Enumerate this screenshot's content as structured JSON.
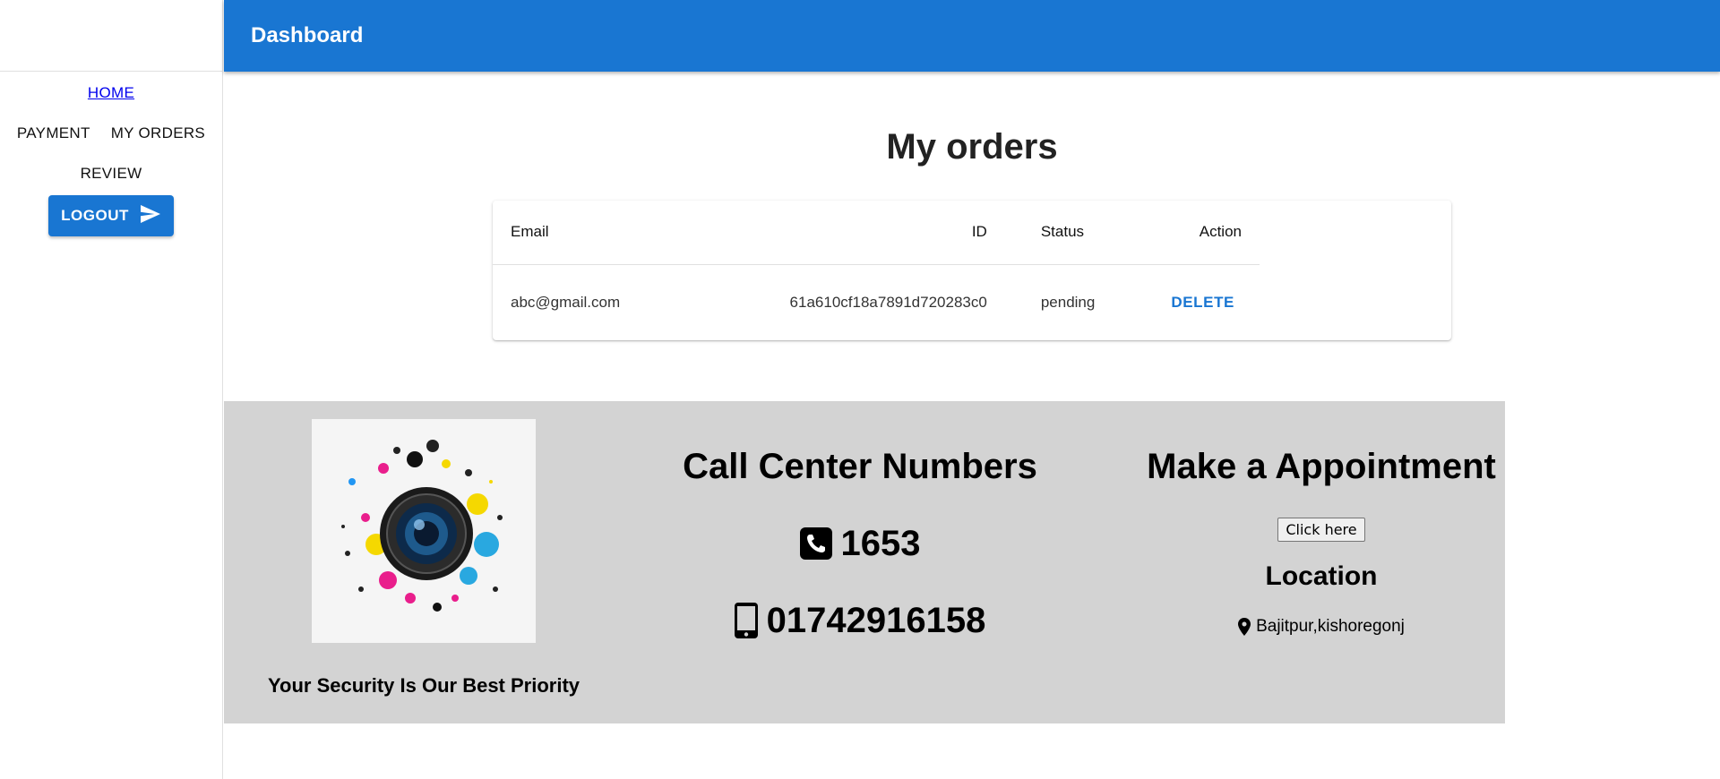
{
  "appbar": {
    "title": "Dashboard"
  },
  "sidebar": {
    "home_label": "HOME",
    "payment_label": "PAYMENT",
    "my_orders_label": "MY ORDERS",
    "review_label": "REVIEW",
    "logout_label": "LOGOUT",
    "logout_icon": "send-icon"
  },
  "main": {
    "title": "My orders",
    "table": {
      "headers": {
        "email": "Email",
        "id": "ID",
        "status": "Status",
        "action": "Action"
      },
      "rows": [
        {
          "email": "abc@gmail.com",
          "id": "61a610cf18a7891d720283c0",
          "status": "pending",
          "action": "DELETE"
        }
      ]
    }
  },
  "footer": {
    "tagline": "Your Security Is Our Best Priority",
    "call_center": {
      "title": "Call Center Numbers",
      "phone_1": "1653",
      "phone_1_icon": "phone-square-icon",
      "phone_2": "01742916158",
      "phone_2_icon": "mobile-phone-icon"
    },
    "appointment": {
      "title": "Make a Appointment",
      "button_label": "Click here"
    },
    "location": {
      "title": "Location",
      "address": "Bajitpur,kishoregonj",
      "icon": "map-pin-icon"
    }
  },
  "colors": {
    "primary": "#1976d2",
    "footer_bg": "#d3d3d3",
    "link": "#0000ee"
  }
}
